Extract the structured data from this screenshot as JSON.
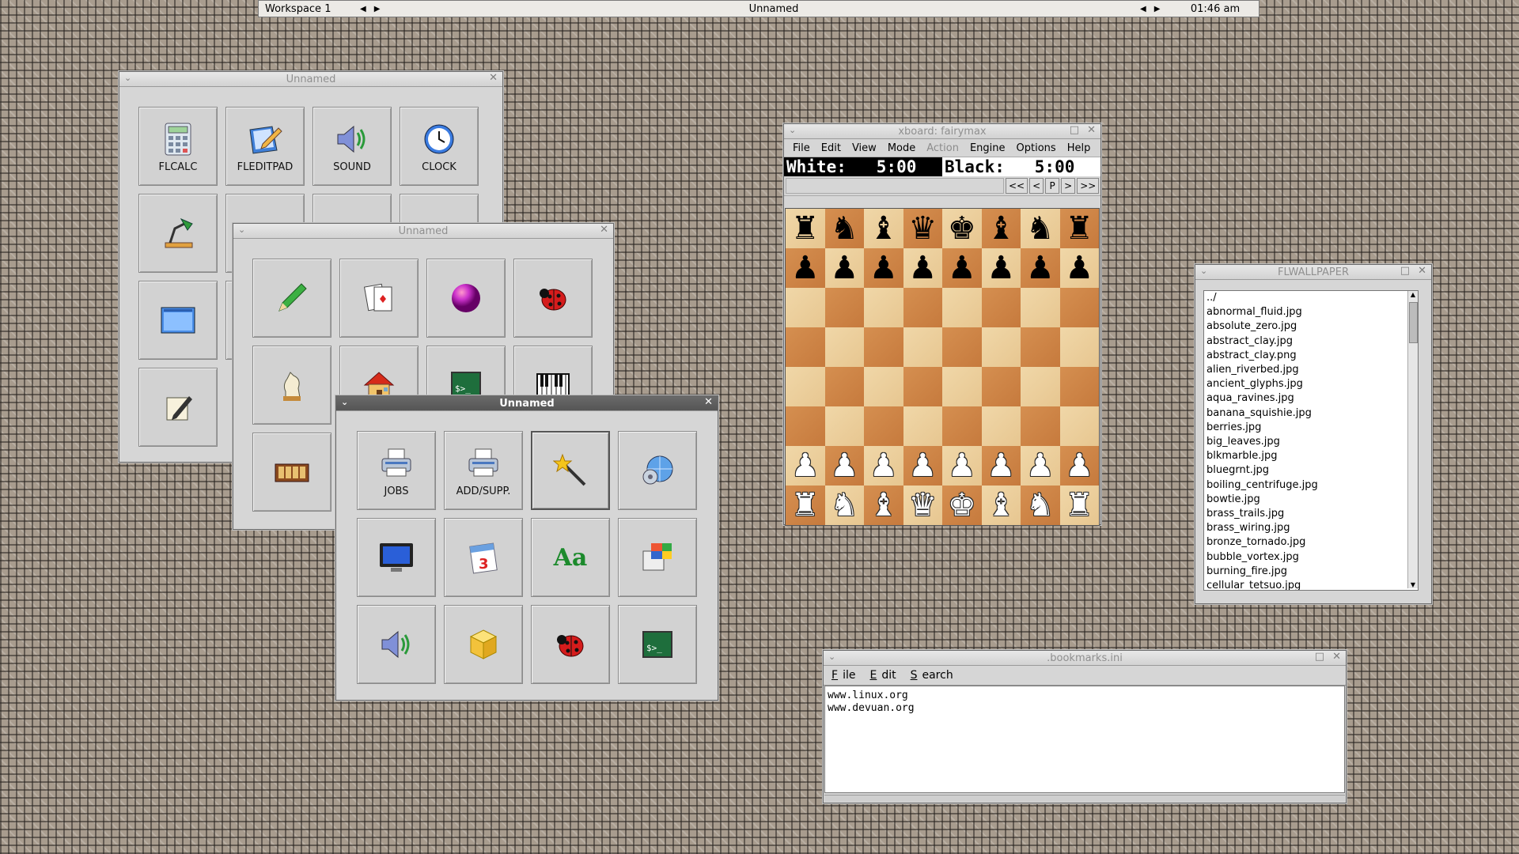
{
  "taskbar": {
    "workspace": "Workspace 1",
    "title": "Unnamed",
    "clock": "01:46 am"
  },
  "win1": {
    "title": "Unnamed",
    "buttons": [
      {
        "label": "FLCALC",
        "icon": "calculator-icon"
      },
      {
        "label": "FLEDITPAD",
        "icon": "editpad-icon"
      },
      {
        "label": "SOUND",
        "icon": "speaker-icon"
      },
      {
        "label": "CLOCK",
        "icon": "clock-icon"
      },
      {
        "label": "",
        "icon": "desk-lamp-icon"
      },
      {
        "label": "",
        "icon": "partial-icon"
      },
      {
        "label": "",
        "icon": "partial-icon"
      },
      {
        "label": "",
        "icon": "partial-icon"
      },
      {
        "label": "",
        "icon": "window-icon"
      },
      {
        "label": "",
        "icon": "partial-icon"
      },
      {
        "label": "",
        "icon": "partial-icon"
      },
      {
        "label": "",
        "icon": "partial-icon"
      },
      {
        "label": "",
        "icon": "pen-paper-icon"
      }
    ]
  },
  "win2": {
    "title": "Unnamed",
    "buttons": [
      {
        "label": "",
        "icon": "pencil-icon"
      },
      {
        "label": "",
        "icon": "cards-icon"
      },
      {
        "label": "",
        "icon": "marble-icon"
      },
      {
        "label": "",
        "icon": "ladybug-icon"
      },
      {
        "label": "",
        "icon": "chess-knight-icon"
      },
      {
        "label": "",
        "icon": "house-icon"
      },
      {
        "label": "",
        "icon": "terminal-icon"
      },
      {
        "label": "",
        "icon": "piano-icon"
      },
      {
        "label": "",
        "icon": "mahjong-icon"
      }
    ]
  },
  "win3": {
    "title": "Unnamed",
    "buttons": [
      {
        "label": "JOBS",
        "icon": "printer-icon"
      },
      {
        "label": "ADD/SUPP.",
        "icon": "printer-add-icon"
      },
      {
        "label": "",
        "icon": "magic-wand-icon"
      },
      {
        "label": "",
        "icon": "network-gear-icon"
      },
      {
        "label": "",
        "icon": "monitor-icon"
      },
      {
        "label": "",
        "icon": "calendar-icon"
      },
      {
        "label": "Aa",
        "icon": "font-icon"
      },
      {
        "label": "",
        "icon": "windows-flag-icon"
      },
      {
        "label": "",
        "icon": "speaker-icon"
      },
      {
        "label": "",
        "icon": "cube-icon"
      },
      {
        "label": "",
        "icon": "ladybug-icon"
      },
      {
        "label": "",
        "icon": "terminal-icon"
      }
    ]
  },
  "xboard": {
    "title": "xboard: fairymax",
    "menu": [
      "File",
      "Edit",
      "View",
      "Mode",
      "Action",
      "Engine",
      "Options",
      "Help"
    ],
    "disabled_menu": [
      "Action"
    ],
    "white_clock": "White:   5:00",
    "black_clock": "Black:   5:00",
    "nav": [
      "<<",
      "<",
      "P",
      ">",
      ">>"
    ],
    "board": [
      [
        "♜",
        "♞",
        "♝",
        "♛",
        "♚",
        "♝",
        "♞",
        "♜"
      ],
      [
        "♟",
        "♟",
        "♟",
        "♟",
        "♟",
        "♟",
        "♟",
        "♟"
      ],
      [
        "",
        "",
        "",
        "",
        "",
        "",
        "",
        ""
      ],
      [
        "",
        "",
        "",
        "",
        "",
        "",
        "",
        ""
      ],
      [
        "",
        "",
        "",
        "",
        "",
        "",
        "",
        ""
      ],
      [
        "",
        "",
        "",
        "",
        "",
        "",
        "",
        ""
      ],
      [
        "♙",
        "♙",
        "♙",
        "♙",
        "♙",
        "♙",
        "♙",
        "♙"
      ],
      [
        "♖",
        "♘",
        "♗",
        "♕",
        "♔",
        "♗",
        "♘",
        "♖"
      ]
    ]
  },
  "wallpaper": {
    "title": "FLWALLPAPER",
    "files": [
      "../",
      "abnormal_fluid.jpg",
      "absolute_zero.jpg",
      "abstract_clay.jpg",
      "abstract_clay.png",
      "alien_riverbed.jpg",
      "ancient_glyphs.jpg",
      "aqua_ravines.jpg",
      "banana_squishie.jpg",
      "berries.jpg",
      "big_leaves.jpg",
      "blkmarble.jpg",
      "bluegrnt.jpg",
      "boiling_centrifuge.jpg",
      "bowtie.jpg",
      "brass_trails.jpg",
      "brass_wiring.jpg",
      "bronze_tornado.jpg",
      "bubble_vortex.jpg",
      "burning_fire.jpg",
      "cellular_tetsuo.jpg"
    ]
  },
  "bookmarks": {
    "title": ".bookmarks.ini",
    "menu": [
      "File",
      "Edit",
      "Search"
    ],
    "lines": [
      "www.linux.org",
      "www.devuan.org"
    ]
  }
}
